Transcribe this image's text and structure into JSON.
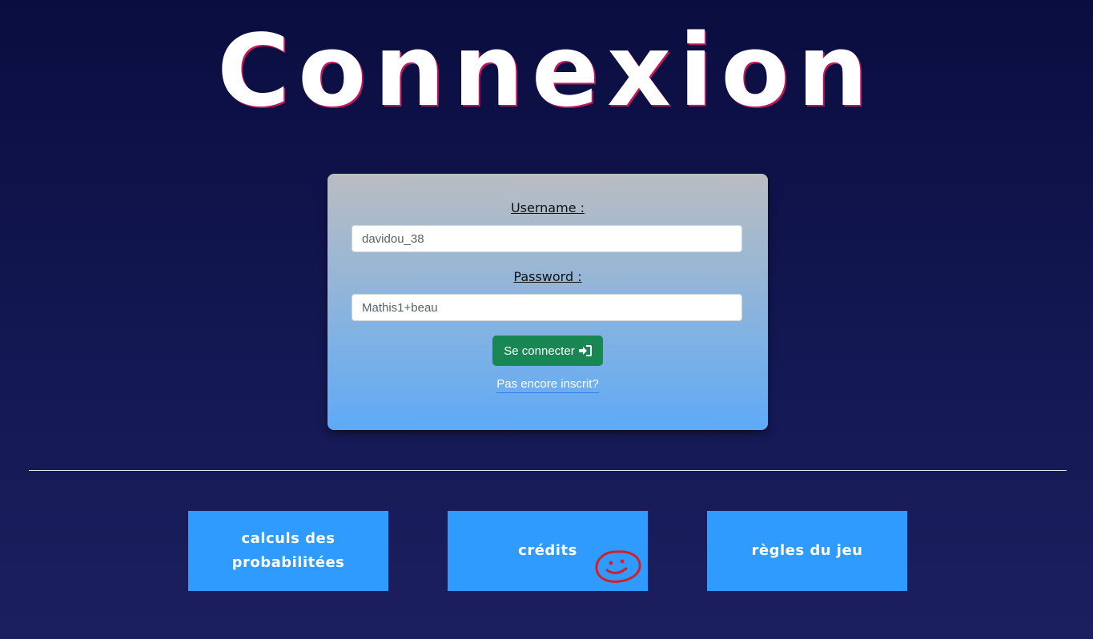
{
  "page": {
    "title": "Connexion"
  },
  "login": {
    "username_label": "Username :",
    "username_value": "davidou_38",
    "password_label": "Password :",
    "password_value": "Mathis1+beau",
    "submit_label": "Se connecter",
    "submit_icon": "sign-in-icon",
    "signup_link": "Pas encore inscrit?"
  },
  "nav": {
    "buttons": [
      {
        "line1": "calculs des",
        "line2": "probabilitées"
      },
      {
        "label": "crédits"
      },
      {
        "label": "règles du jeu"
      }
    ]
  },
  "annotation": {
    "icon": "smiley-doodle-icon",
    "color": "#d0202a"
  },
  "colors": {
    "background": "#0a0d3f",
    "nav_button": "#2f9bff",
    "submit_button": "#198754",
    "card_top": "#babdc2",
    "card_bottom": "#5eaaf8"
  }
}
